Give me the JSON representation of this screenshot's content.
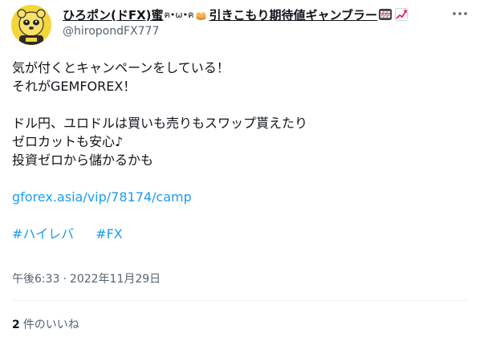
{
  "tweet": {
    "display_name": "ひろポン(ドFX)",
    "name_kanji": "蜜",
    "name_emoji_suffix": "ฅ•ω•ฅ",
    "name_tagline": "引きこもり期待値ギャンブラー",
    "handle": "@hiropondFX777",
    "lines": [
      "気が付くとキャンペーンをしている！",
      "それがGEMFOREX！",
      "ドル円、ユロドルは買いも売りもスワップ貰えたり",
      "ゼロカットも安心♪",
      "投資ゼロから儲かるかも"
    ],
    "link": "gforex.asia/vip/78174/camp",
    "hashtags": [
      "#ハイレバ",
      "#FX"
    ],
    "time": "午後6:33",
    "separator": "·",
    "date": "2022年11月29日",
    "likes_count": "2",
    "likes_label": "件のいいね",
    "colors": {
      "link": "#1d9bf0",
      "secondary": "#536471",
      "text": "#0f1419"
    }
  }
}
